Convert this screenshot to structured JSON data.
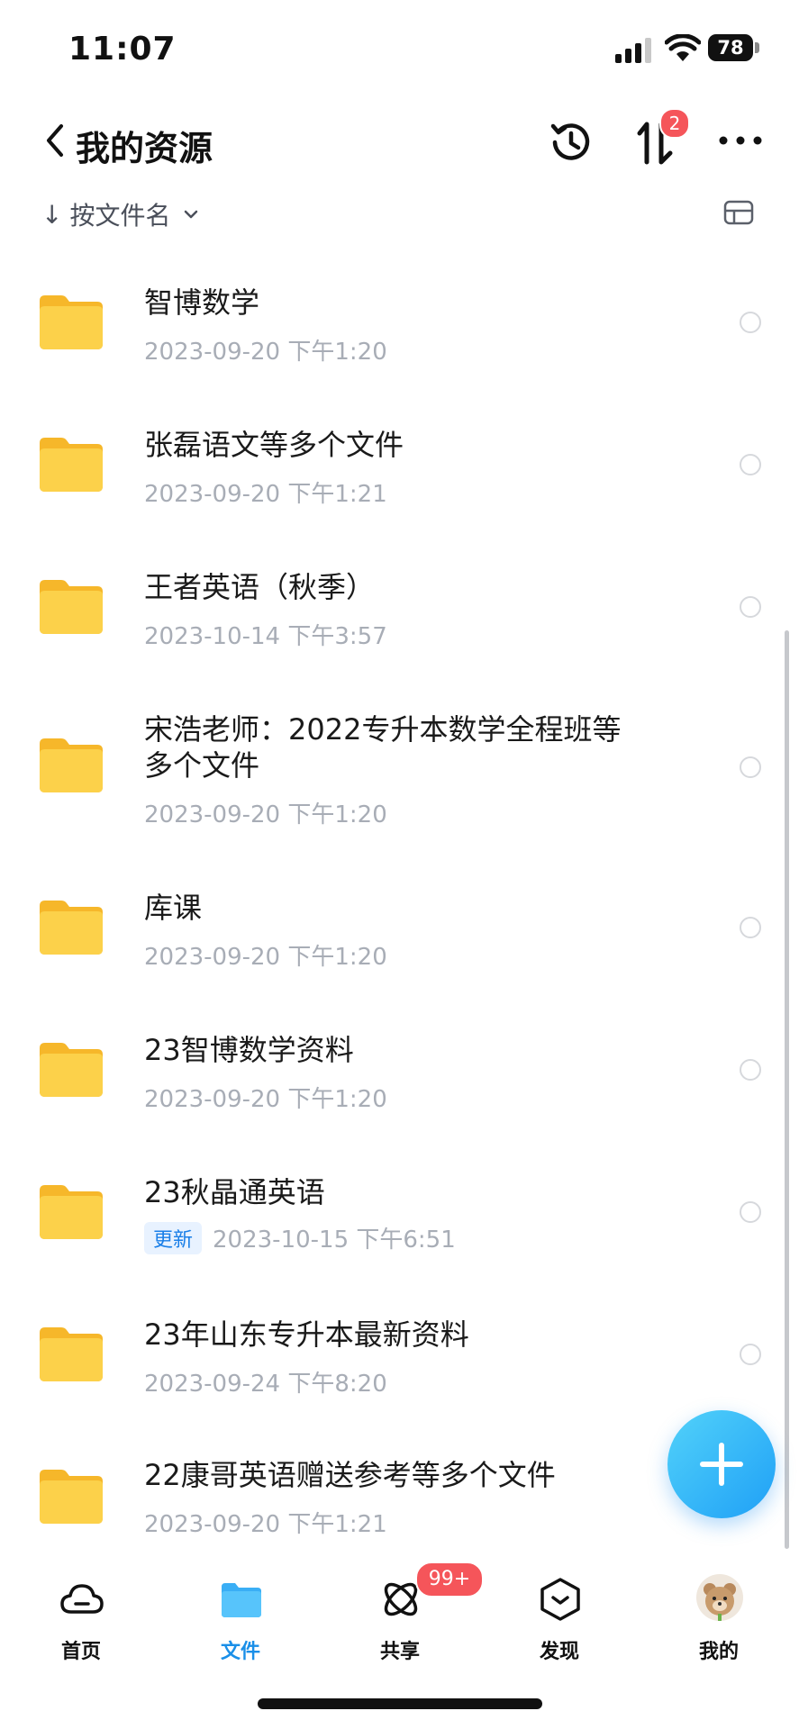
{
  "status_bar": {
    "time": "11:07",
    "battery": "78"
  },
  "header": {
    "title": "我的资源",
    "transfer_badge": "2"
  },
  "sort": {
    "label": "按文件名"
  },
  "files": [
    {
      "name": "智博数学",
      "date": "2023-09-20 下午1:20"
    },
    {
      "name": "张磊语文等多个文件",
      "date": "2023-09-20 下午1:21"
    },
    {
      "name": "王者英语（秋季）",
      "date": "2023-10-14 下午3:57"
    },
    {
      "name_line1": "宋浩老师：2022专升本数学全程班等",
      "name_line2": "多个文件",
      "date": "2023-09-20 下午1:20"
    },
    {
      "name": "库课",
      "date": "2023-09-20 下午1:20"
    },
    {
      "name": "23智博数学资料",
      "date": "2023-09-20 下午1:20"
    },
    {
      "name": "23秋晶通英语",
      "tag": "更新",
      "date": "2023-10-15 下午6:51"
    },
    {
      "name": "23年山东专升本最新资料",
      "date": "2023-09-24 下午8:20"
    },
    {
      "name": "22康哥英语赠送参考等多个文件",
      "date": "2023-09-20 下午1:21"
    }
  ],
  "tabs": {
    "home": "首页",
    "files": "文件",
    "share": "共享",
    "share_badge": "99+",
    "discover": "发现",
    "mine": "我的"
  },
  "colors": {
    "accent": "#1a8fe8",
    "badge": "#f5555a",
    "folder": "#fcc736"
  }
}
